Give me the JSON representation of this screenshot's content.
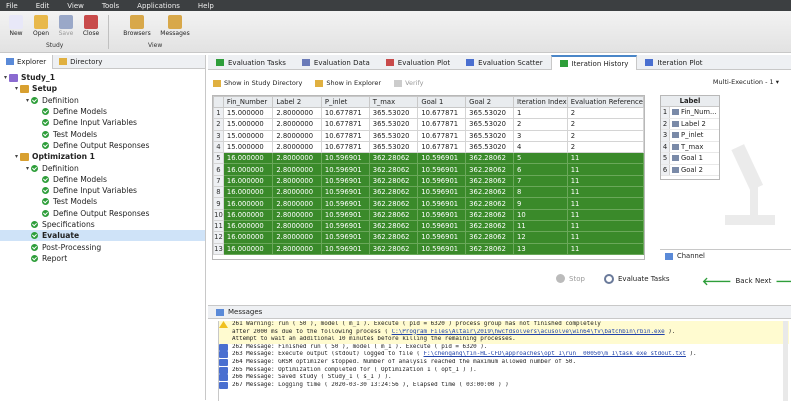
{
  "menu": [
    "File",
    "Edit",
    "View",
    "Tools",
    "Applications",
    "Help"
  ],
  "toolbar": {
    "study_buttons": [
      {
        "label": "New",
        "icon": "new-icon",
        "color": "#e8e8f8"
      },
      {
        "label": "Open",
        "icon": "open-folder-icon",
        "color": "#e8b84a"
      },
      {
        "label": "Save",
        "icon": "save-icon",
        "color": "#9aa8c8",
        "disabled": true
      },
      {
        "label": "Close",
        "icon": "close-icon",
        "color": "#c84a4a"
      }
    ],
    "study_group": "Study",
    "view_buttons": [
      {
        "label": "Browsers",
        "icon": "browsers-icon",
        "color": "#d8a84a"
      },
      {
        "label": "Messages",
        "icon": "messages-icon",
        "color": "#d8a84a"
      }
    ],
    "view_group": "View"
  },
  "left_tabs": [
    "Explorer",
    "Directory"
  ],
  "tree": [
    {
      "label": "Study_1",
      "level": 0,
      "twisty": "▾",
      "icon": "study",
      "bold": true
    },
    {
      "label": "Setup",
      "level": 1,
      "twisty": "▾",
      "icon": "setup",
      "bold": true
    },
    {
      "label": "Definition",
      "level": 2,
      "twisty": "▾",
      "icon": "check"
    },
    {
      "label": "Define Models",
      "level": 3,
      "icon": "check"
    },
    {
      "label": "Define Input Variables",
      "level": 3,
      "icon": "check"
    },
    {
      "label": "Test Models",
      "level": 3,
      "icon": "check"
    },
    {
      "label": "Define Output Responses",
      "level": 3,
      "icon": "check"
    },
    {
      "label": "Optimization 1",
      "level": 1,
      "twisty": "▾",
      "icon": "setup",
      "bold": true
    },
    {
      "label": "Definition",
      "level": 2,
      "twisty": "▾",
      "icon": "check"
    },
    {
      "label": "Define Models",
      "level": 3,
      "icon": "check"
    },
    {
      "label": "Define Input Variables",
      "level": 3,
      "icon": "check"
    },
    {
      "label": "Test Models",
      "level": 3,
      "icon": "check"
    },
    {
      "label": "Define Output Responses",
      "level": 3,
      "icon": "check"
    },
    {
      "label": "Specifications",
      "level": 2,
      "icon": "check"
    },
    {
      "label": "Evaluate",
      "level": 2,
      "icon": "check",
      "selected": true,
      "bold": true
    },
    {
      "label": "Post-Processing",
      "level": 2,
      "icon": "check"
    },
    {
      "label": "Report",
      "level": 2,
      "icon": "check"
    }
  ],
  "right_tabs": [
    "Evaluation Tasks",
    "Evaluation Data",
    "Evaluation Plot",
    "Evaluation Scatter",
    "Iteration History",
    "Iteration Plot"
  ],
  "active_right_tab": 4,
  "subbar": {
    "show_study": "Show in Study Directory",
    "show_explorer": "Show in Explorer",
    "verify": "Verify",
    "multi": "Multi-Execution - 1"
  },
  "table": {
    "columns": [
      "Fin_Number",
      "Label 2",
      "P_inlet",
      "T_max",
      "Goal 1",
      "Goal 2",
      "Iteration Index",
      "Evaluation Reference"
    ],
    "rows": [
      {
        "n": "1",
        "cells": [
          "15.000000",
          "2.8000000",
          "10.677871",
          "365.53020",
          "10.677871",
          "365.53020",
          "1",
          "2"
        ],
        "green": false
      },
      {
        "n": "2",
        "cells": [
          "15.000000",
          "2.8000000",
          "10.677871",
          "365.53020",
          "10.677871",
          "365.53020",
          "2",
          "2"
        ],
        "green": false
      },
      {
        "n": "3",
        "cells": [
          "15.000000",
          "2.8000000",
          "10.677871",
          "365.53020",
          "10.677871",
          "365.53020",
          "3",
          "2"
        ],
        "green": false
      },
      {
        "n": "4",
        "cells": [
          "15.000000",
          "2.8000000",
          "10.677871",
          "365.53020",
          "10.677871",
          "365.53020",
          "4",
          "2"
        ],
        "green": false
      },
      {
        "n": "5",
        "cells": [
          "16.000000",
          "2.8000000",
          "10.596901",
          "362.28062",
          "10.596901",
          "362.28062",
          "5",
          "11"
        ],
        "green": true
      },
      {
        "n": "6",
        "cells": [
          "16.000000",
          "2.8000000",
          "10.596901",
          "362.28062",
          "10.596901",
          "362.28062",
          "6",
          "11"
        ],
        "green": true
      },
      {
        "n": "7",
        "cells": [
          "16.000000",
          "2.8000000",
          "10.596901",
          "362.28062",
          "10.596901",
          "362.28062",
          "7",
          "11"
        ],
        "green": true
      },
      {
        "n": "8",
        "cells": [
          "16.000000",
          "2.8000000",
          "10.596901",
          "362.28062",
          "10.596901",
          "362.28062",
          "8",
          "11"
        ],
        "green": true
      },
      {
        "n": "9",
        "cells": [
          "16.000000",
          "2.8000000",
          "10.596901",
          "362.28062",
          "10.596901",
          "362.28062",
          "9",
          "11"
        ],
        "green": true
      },
      {
        "n": "10",
        "cells": [
          "16.000000",
          "2.8000000",
          "10.596901",
          "362.28062",
          "10.596901",
          "362.28062",
          "10",
          "11"
        ],
        "green": true
      },
      {
        "n": "11",
        "cells": [
          "16.000000",
          "2.8000000",
          "10.596901",
          "362.28062",
          "10.596901",
          "362.28062",
          "11",
          "11"
        ],
        "green": true
      },
      {
        "n": "12",
        "cells": [
          "16.000000",
          "2.8000000",
          "10.596901",
          "362.28062",
          "10.596901",
          "362.28062",
          "12",
          "11"
        ],
        "green": true
      },
      {
        "n": "13",
        "cells": [
          "16.000000",
          "2.8000000",
          "10.596901",
          "362.28062",
          "10.596901",
          "362.28062",
          "13",
          "11"
        ],
        "green": true
      }
    ]
  },
  "labels_panel": {
    "header": "Label",
    "items": [
      "Fin_Num...",
      "Label 2",
      "P_inlet",
      "T_max",
      "Goal 1",
      "Goal 2"
    ]
  },
  "channel": "Channel",
  "nav": {
    "stop": "Stop",
    "evaluate": "Evaluate Tasks",
    "back": "Back",
    "next": "Next"
  },
  "messages_tab": "Messages",
  "messages": [
    {
      "type": "warning",
      "text": "261 Warning: run ( 50 ), model ( m_1 ). Execute ( pid = 6320 ) process group has not finished completely"
    },
    {
      "type": "cont",
      "text": "after 2000 ms due to the following process ( ",
      "link": "C:\\Program Files\\Altair\\2019\\hwcfdsolvers\\acusolve\\win64\\fv\\batchbin\\rbin.exe",
      "after": " )."
    },
    {
      "type": "cont",
      "text": "Attempt to wait an additional 10 minutes before killing the remaining processes."
    },
    {
      "type": "message",
      "text": "262 Message: Finished run ( 50 ), model ( m_1 ). Execute ( pid = 6320 )."
    },
    {
      "type": "message",
      "text": "263 Message: Execute output (stdout) logged to file ( ",
      "link": "F:\\chengang\\fin-HL-CFD\\approaches\\opt_1\\run__00050\\m_1\\task_exe_stdout.txt",
      "after": " )."
    },
    {
      "type": "message",
      "text": "264 Message: GRSM optimizer stopped. Number of analysis reached the maximum allowed number of 50."
    },
    {
      "type": "message",
      "text": "265 Message: Optimization completed for ( Optimization 1 ( opt_1 ) )."
    },
    {
      "type": "message",
      "text": "266 Message: Saved study ( Study_1 ( s_1 ) )."
    },
    {
      "type": "message",
      "text": "267 Message: Logging time ( 2020-03-30 13:24:56 ), Elapsed time ( 03:00:00 ) )"
    }
  ],
  "colors": {
    "green_row": "#3a8a2a",
    "accent": "#4a86c8",
    "selected": "#cfe3f8"
  }
}
